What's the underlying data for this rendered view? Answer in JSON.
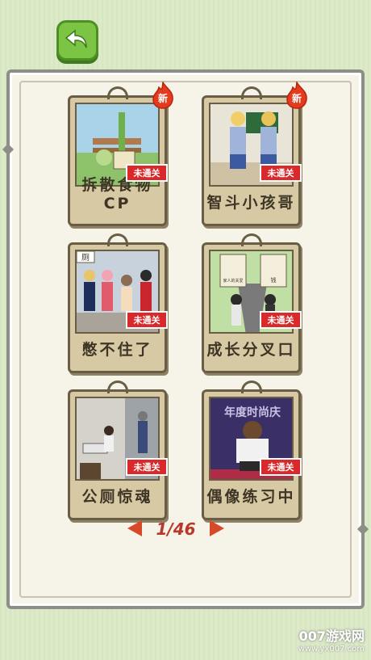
{
  "levels": [
    {
      "title": "拆散食物CP",
      "status": "未通关",
      "new_badge": "新"
    },
    {
      "title": "智斗小孩哥",
      "status": "未通关",
      "new_badge": "新"
    },
    {
      "title": "憋不住了",
      "status": "未通关",
      "new_badge": ""
    },
    {
      "title": "成长分叉口",
      "status": "未通关",
      "new_badge": ""
    },
    {
      "title": "公厕惊魂",
      "status": "未通关",
      "new_badge": ""
    },
    {
      "title": "偶像练习中",
      "status": "未通关",
      "new_badge": ""
    }
  ],
  "pic_text": {
    "toilet_sign": "厕",
    "choice_left": "家人的关爱",
    "choice_right": "钱",
    "idol_banner": "年度时尚庆"
  },
  "pager": {
    "text": "1/46"
  },
  "watermark": {
    "name": "007游戏网",
    "url": "www.yx007.com"
  },
  "colors": {
    "accent": "#7cc443",
    "status_red": "#d9292b",
    "arrow": "#d64a2a"
  }
}
